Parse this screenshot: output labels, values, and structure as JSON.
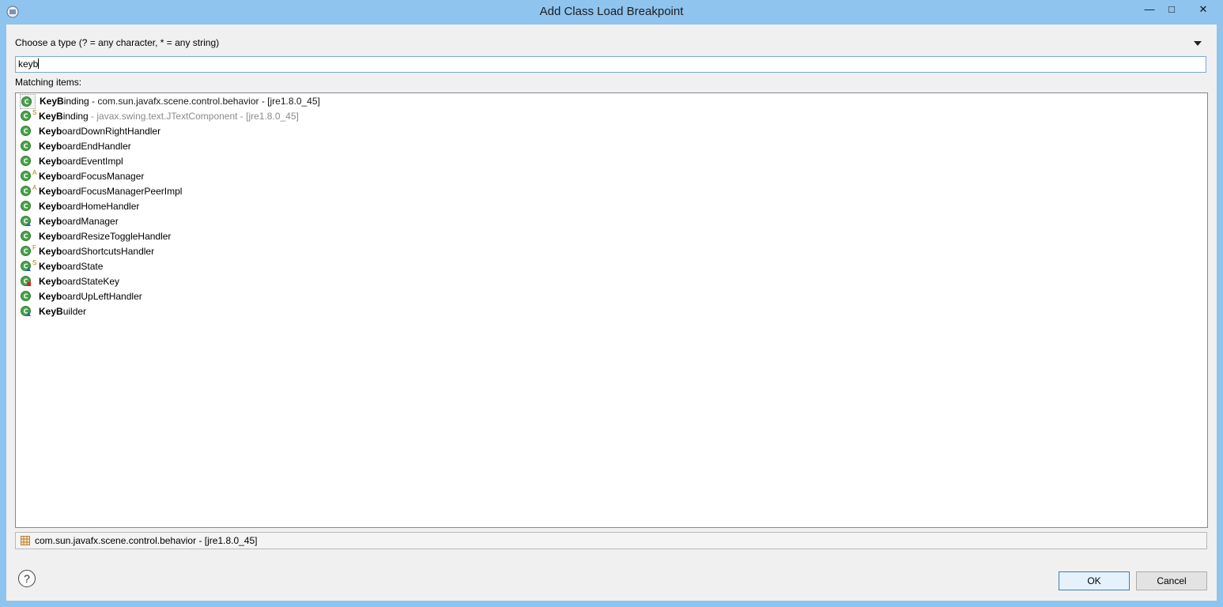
{
  "window": {
    "title": "Add Class Load Breakpoint"
  },
  "chooser": {
    "type_label": "Choose a type (? = any character, * = any string)",
    "filter_value": "keyb",
    "matching_label": "Matching items:"
  },
  "items": [
    {
      "match": "KeyB",
      "rest": "inding",
      "qualifier": " - com.sun.javafx.scene.control.behavior - [jre1.8.0_45]",
      "dim": false,
      "selected": true,
      "modifier": "",
      "icon": "class-icon"
    },
    {
      "match": "KeyB",
      "rest": "inding",
      "qualifier": " - javax.swing.text.JTextComponent - [jre1.8.0_45]",
      "dim": true,
      "selected": false,
      "modifier": "S",
      "icon": "class-icon"
    },
    {
      "match": "Keyb",
      "rest": "oardDownRightHandler",
      "qualifier": "",
      "dim": false,
      "selected": false,
      "modifier": "",
      "icon": "class-icon"
    },
    {
      "match": "Keyb",
      "rest": "oardEndHandler",
      "qualifier": "",
      "dim": false,
      "selected": false,
      "modifier": "",
      "icon": "class-icon"
    },
    {
      "match": "Keyb",
      "rest": "oardEventImpl",
      "qualifier": "",
      "dim": false,
      "selected": false,
      "modifier": "",
      "icon": "class-icon"
    },
    {
      "match": "Keyb",
      "rest": "oardFocusManager",
      "qualifier": "",
      "dim": false,
      "selected": false,
      "modifier": "A",
      "icon": "class-icon"
    },
    {
      "match": "Keyb",
      "rest": "oardFocusManagerPeerImpl",
      "qualifier": "",
      "dim": false,
      "selected": false,
      "modifier": "A",
      "icon": "class-icon"
    },
    {
      "match": "Keyb",
      "rest": "oardHomeHandler",
      "qualifier": "",
      "dim": false,
      "selected": false,
      "modifier": "",
      "icon": "class-icon"
    },
    {
      "match": "Keyb",
      "rest": "oardManager",
      "qualifier": "",
      "dim": false,
      "selected": false,
      "modifier": "",
      "icon": "class-default-icon"
    },
    {
      "match": "Keyb",
      "rest": "oardResizeToggleHandler",
      "qualifier": "",
      "dim": false,
      "selected": false,
      "modifier": "",
      "icon": "class-icon"
    },
    {
      "match": "Keyb",
      "rest": "oardShortcutsHandler",
      "qualifier": "",
      "dim": false,
      "selected": false,
      "modifier": "F",
      "icon": "class-icon"
    },
    {
      "match": "Keyb",
      "rest": "oardState",
      "qualifier": "",
      "dim": false,
      "selected": false,
      "modifier": "S",
      "icon": "class-default-icon"
    },
    {
      "match": "Keyb",
      "rest": "oardStateKey",
      "qualifier": "",
      "dim": false,
      "selected": false,
      "modifier": "",
      "icon": "class-private-icon"
    },
    {
      "match": "Keyb",
      "rest": "oardUpLeftHandler",
      "qualifier": "",
      "dim": false,
      "selected": false,
      "modifier": "",
      "icon": "class-icon"
    },
    {
      "match": "KeyB",
      "rest": "uilder",
      "qualifier": "",
      "dim": false,
      "selected": false,
      "modifier": "",
      "icon": "class-default-icon"
    }
  ],
  "status": {
    "package": "com.sun.javafx.scene.control.behavior - [jre1.8.0_45]",
    "icon": "package-icon"
  },
  "buttons": {
    "ok": "OK",
    "cancel": "Cancel",
    "help": "?"
  },
  "colors": {
    "titlebar": "#8ec4ee",
    "class_green": "#4aa34a",
    "focus_border": "#7aa9d6"
  }
}
